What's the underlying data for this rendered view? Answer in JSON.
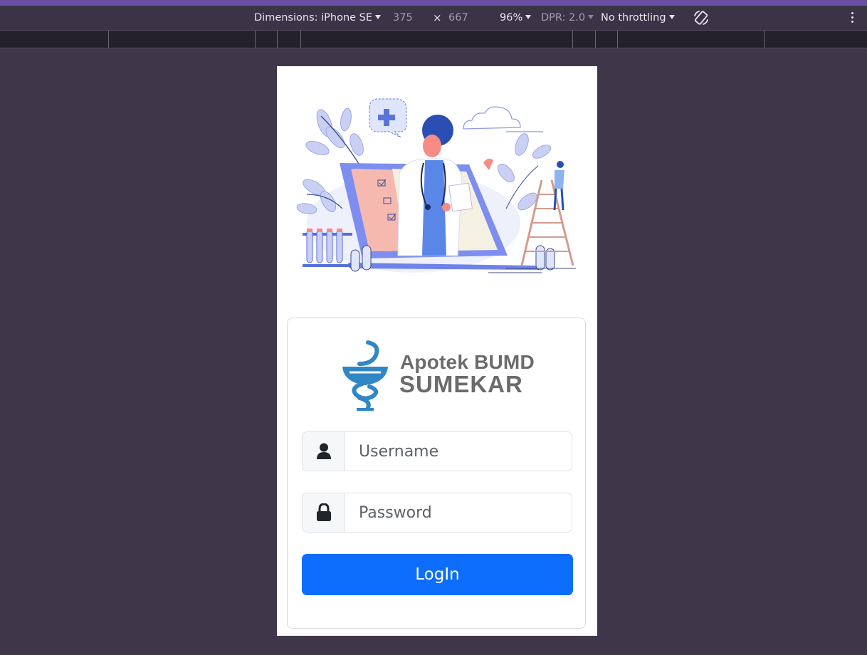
{
  "devtools": {
    "dimensions_label": "Dimensions: iPhone SE",
    "width": "375",
    "times": "×",
    "height": "667",
    "zoom": "96%",
    "dpr": "DPR: 2.0",
    "throttling": "No throttling",
    "icons": {
      "rotate": "rotate-icon",
      "menu": "more-vertical-icon",
      "caret": "caret-down-icon"
    }
  },
  "login": {
    "brand_line1": "Apotek BUMD",
    "brand_line2": "SUMEKAR",
    "username_placeholder": "Username",
    "password_placeholder": "Password",
    "button_label": "LogIn",
    "icons": {
      "username": "user-icon",
      "password": "lock-icon",
      "logo": "snake-bowl-pharmacy-logo"
    }
  },
  "colors": {
    "primary": "#0d6efd",
    "page_bg": "#3f3749",
    "brand_blue": "#2f87c6",
    "brand_text": "#6b6b6b"
  }
}
